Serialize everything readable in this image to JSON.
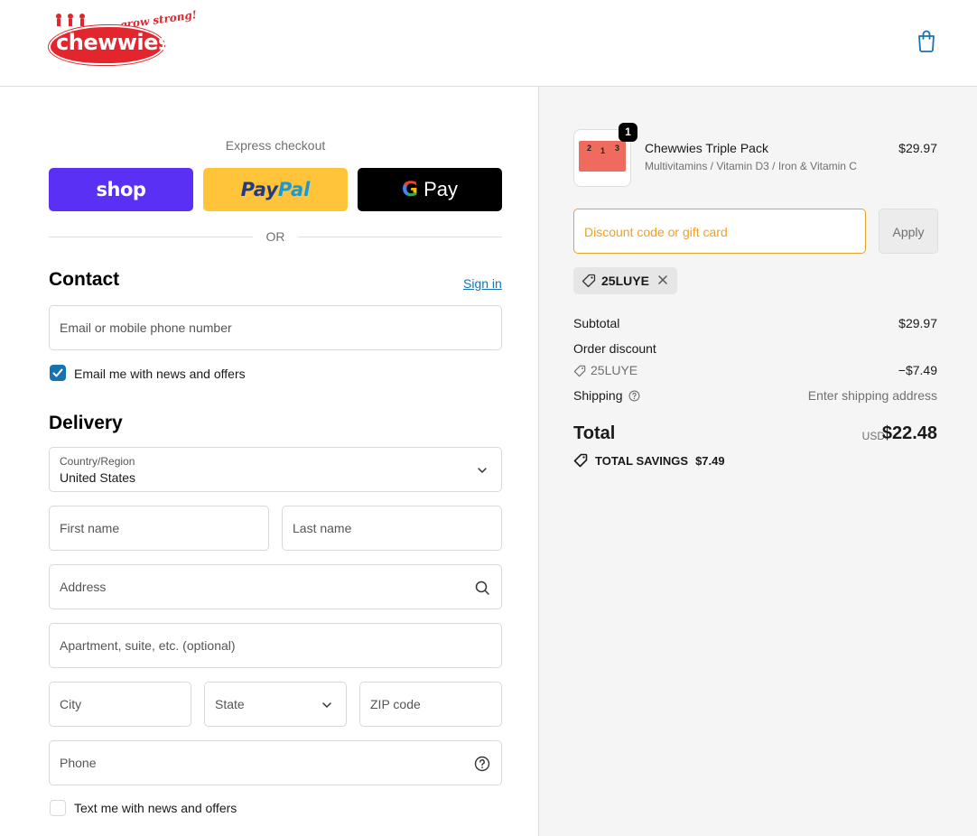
{
  "brand": {
    "name": "chewwies",
    "tagline": "grow strong!"
  },
  "header": {
    "cart_icon": "shopping-bag-icon"
  },
  "express": {
    "title": "Express checkout",
    "shop_label": "shop",
    "paypal_label_a": "Pay",
    "paypal_label_b": "Pal",
    "gpay_g": "G",
    "gpay_label": "Pay",
    "or_label": "OR"
  },
  "contact": {
    "title": "Contact",
    "sign_in": "Sign in",
    "email_placeholder": "Email or mobile phone number",
    "news_label": "Email me with news and offers",
    "news_checked": true
  },
  "delivery": {
    "title": "Delivery",
    "country_label": "Country/Region",
    "country_value": "United States",
    "first_name": "First name",
    "last_name": "Last name",
    "address": "Address",
    "apartment": "Apartment, suite, etc. (optional)",
    "city": "City",
    "state": "State",
    "zip": "ZIP code",
    "phone": "Phone",
    "sms_label": "Text me with news and offers",
    "sms_checked": false
  },
  "summary": {
    "product": {
      "name": "Chewwies Triple Pack",
      "variant": "Multivitamins / Vitamin D3 / Iron & Vitamin C",
      "price": "$29.97",
      "quantity": "1",
      "thumb_numbers": [
        "2",
        "1",
        "3"
      ]
    },
    "discount_placeholder": "Discount code or gift card",
    "apply_label": "Apply",
    "applied_code": "25LUYE",
    "subtotal_label": "Subtotal",
    "subtotal_value": "$29.97",
    "order_discount_label": "Order discount",
    "discount_code": "25LUYE",
    "discount_value": "−$7.49",
    "shipping_label": "Shipping",
    "shipping_value": "Enter shipping address",
    "total_label": "Total",
    "total_currency": "USD",
    "total_value": "$22.48",
    "savings_label": "TOTAL SAVINGS",
    "savings_value": "$7.49"
  },
  "colors": {
    "shop_pay": "#5a31f4",
    "paypal": "#ffc439",
    "link": "#1773b0",
    "discount_accent": "#f0a020",
    "brand_red": "#e3262e"
  }
}
